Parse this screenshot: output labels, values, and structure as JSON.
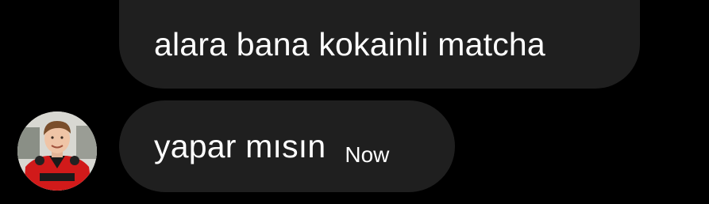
{
  "messages": [
    {
      "text": "alara bana kokainli matcha"
    },
    {
      "text": "yapar mısın",
      "timestamp": "Now"
    }
  ],
  "colors": {
    "background": "#000000",
    "bubble": "#1f1f1f",
    "text": "#ffffff"
  },
  "avatar": {
    "icon": "user-avatar-photo"
  }
}
